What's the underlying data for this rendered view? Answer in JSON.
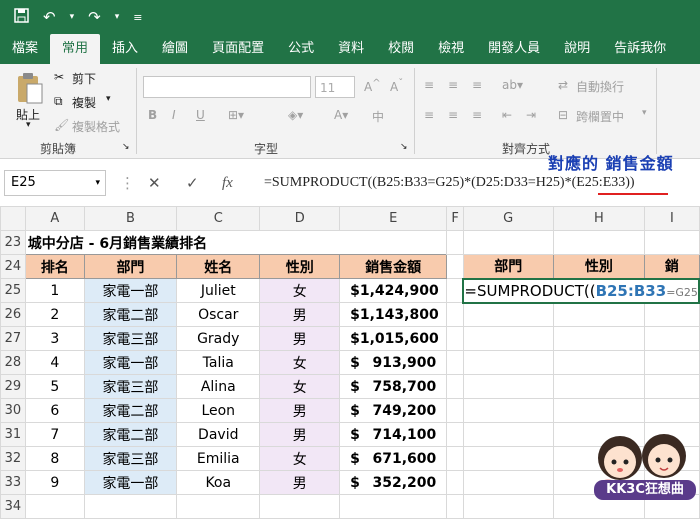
{
  "titlebar": {
    "save_icon": "save-icon",
    "undo_icon": "undo-icon",
    "redo_icon": "redo-icon",
    "customize_icon": "customize-icon"
  },
  "tabs": [
    "檔案",
    "常用",
    "插入",
    "繪圖",
    "頁面配置",
    "公式",
    "資料",
    "校閱",
    "檢視",
    "開發人員",
    "說明",
    "告訴我你"
  ],
  "ribbon": {
    "paste": "貼上",
    "cut": "剪下",
    "copy": "複製",
    "format_painter": "複製格式",
    "clipboard_group": "剪貼簿",
    "font_size": "11",
    "bold": "B",
    "italic": "I",
    "underline": "U",
    "font_group": "字型",
    "phonetic": "中",
    "wrap_text": "自動換行",
    "merge_center": "跨欄置中",
    "alignment_group": "對齊方式"
  },
  "formula_bar": {
    "name_box": "E25",
    "cancel": "✕",
    "enter": "✓",
    "fx": "fx",
    "formula_prefix": "=SUMPRODUCT((B25:B33=G25)*(D25:D33=H25)*",
    "formula_highlight": "(E25:E33)",
    "formula_suffix": ")"
  },
  "annotation": "對應的 銷售金額",
  "columns": [
    "A",
    "B",
    "C",
    "D",
    "E",
    "F",
    "G",
    "H",
    "I"
  ],
  "row_numbers": [
    "23",
    "24",
    "25",
    "26",
    "27",
    "28",
    "29",
    "30",
    "31",
    "32",
    "33",
    "34"
  ],
  "sheet_title": "城中分店 - 6月銷售業績排名",
  "headers": [
    "排名",
    "部門",
    "姓名",
    "性別",
    "銷售金額"
  ],
  "right_headers": [
    "部門",
    "性別",
    "銷"
  ],
  "rows": [
    {
      "rank": "1",
      "dept": "家電一部",
      "name": "Juliet",
      "gender": "女",
      "amount": "1,424,900"
    },
    {
      "rank": "2",
      "dept": "家電二部",
      "name": "Oscar",
      "gender": "男",
      "amount": "1,143,800"
    },
    {
      "rank": "3",
      "dept": "家電三部",
      "name": "Grady",
      "gender": "男",
      "amount": "1,015,600"
    },
    {
      "rank": "4",
      "dept": "家電一部",
      "name": "Talia",
      "gender": "女",
      "amount": "913,900"
    },
    {
      "rank": "5",
      "dept": "家電三部",
      "name": "Alina",
      "gender": "女",
      "amount": "758,700"
    },
    {
      "rank": "6",
      "dept": "家電二部",
      "name": "Leon",
      "gender": "男",
      "amount": "749,200"
    },
    {
      "rank": "7",
      "dept": "家電二部",
      "name": "David",
      "gender": "男",
      "amount": "714,100"
    },
    {
      "rank": "8",
      "dept": "家電三部",
      "name": "Emilia",
      "gender": "女",
      "amount": "671,600"
    },
    {
      "rank": "9",
      "dept": "家電一部",
      "name": "Koa",
      "gender": "男",
      "amount": "352,200"
    }
  ],
  "currency": "$",
  "edit_cell": {
    "prefix": "=SUMPRODUCT((",
    "ref": "B25:B33",
    "suffix": "=G25"
  },
  "logo_text": "KK3C狂想曲"
}
